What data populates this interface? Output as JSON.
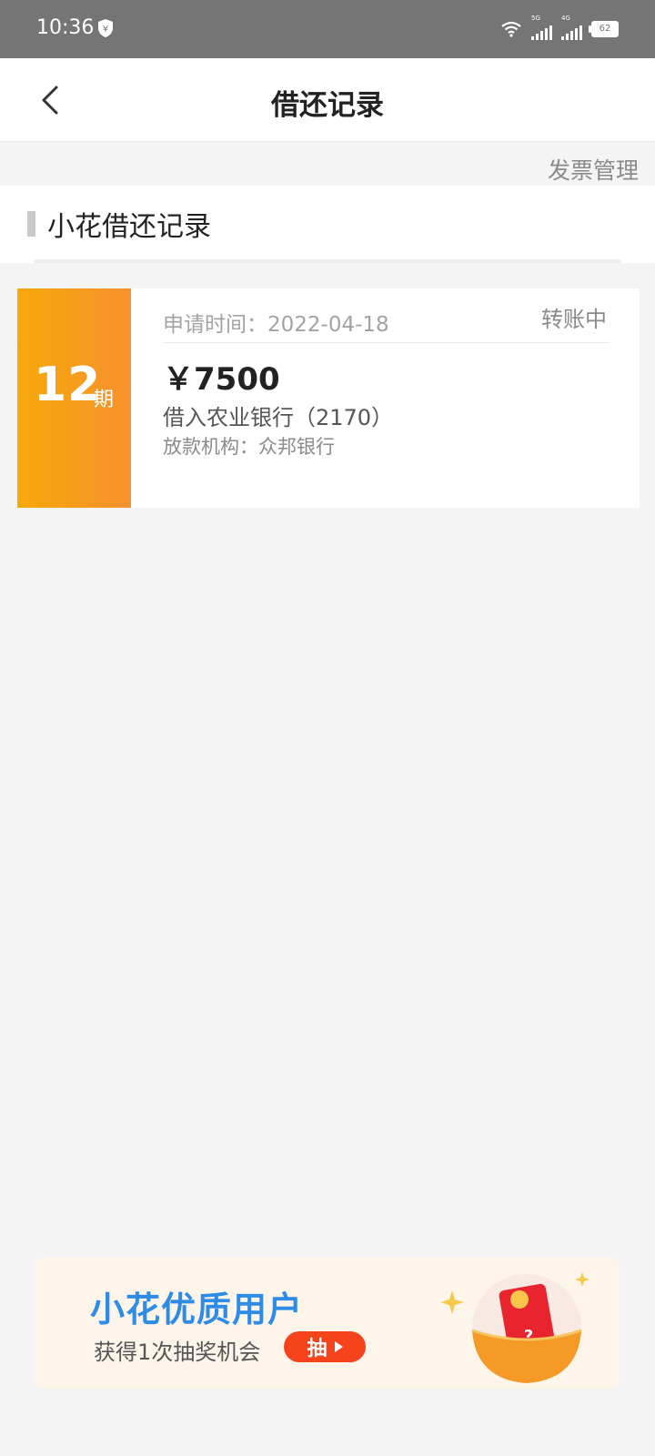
{
  "status_bar": {
    "time": "10:36",
    "network_labels": [
      "5G",
      "4G"
    ],
    "battery": "62",
    "icons": [
      "shield-yen-icon",
      "wifi-icon",
      "signal-5g-icon",
      "signal-4g-icon",
      "battery-icon"
    ]
  },
  "header": {
    "title": "借还记录",
    "back_icon": "chevron-left-icon"
  },
  "invoice_link": "发票管理",
  "section": {
    "title": "小花借还记录"
  },
  "record": {
    "term_number": "12",
    "term_unit": "期",
    "apply_time": "申请时间：2022-04-18",
    "status": "转账中",
    "amount": "￥7500",
    "bank": "借入农业银行（2170）",
    "lender": "放款机构：众邦银行"
  },
  "promo": {
    "title": "小花优质用户",
    "subtitle": "获得1次抽奖机会",
    "button_label": "抽",
    "colors": {
      "title": "#2e8be6",
      "button": "#f5441c"
    }
  },
  "colors": {
    "status_bar": "#757575",
    "term_gradient_start": "#f5a90a",
    "term_gradient_end": "#f7912e",
    "page_background": "#f4f4f4"
  }
}
